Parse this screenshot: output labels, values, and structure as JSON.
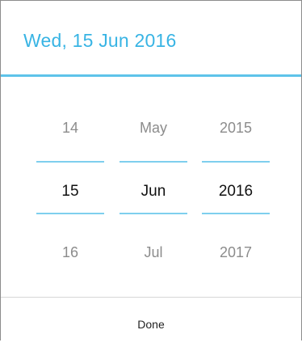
{
  "header": {
    "title": "Wed, 15 Jun 2016"
  },
  "picker": {
    "day": {
      "prev": "14",
      "current": "15",
      "next": "16"
    },
    "month": {
      "prev": "May",
      "current": "Jun",
      "next": "Jul"
    },
    "year": {
      "prev": "2015",
      "current": "2016",
      "next": "2017"
    }
  },
  "footer": {
    "done_label": "Done"
  },
  "colors": {
    "accent": "#38b4e4",
    "divider": "#7fcfee"
  }
}
